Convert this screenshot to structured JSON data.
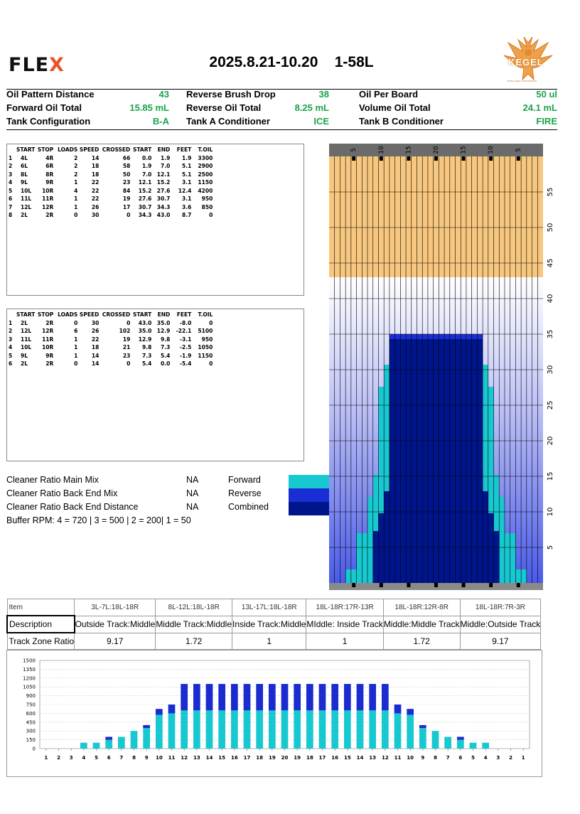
{
  "brand": {
    "name_main": "FLE",
    "name_x": "X",
    "kegel_text": "KEGEL",
    "kegel_tagline": "YOUR LANES. OUR PASSION."
  },
  "title": "2025.8.21-10.20    1-58L",
  "colors": {
    "green": "#19a34a",
    "dry": "#f7c77f",
    "white_band": "#ffffff",
    "forward": "#18c8d0",
    "reverse": "#1a2ed6",
    "combined": "#00158c"
  },
  "info": [
    {
      "label": "Oil Pattern Distance",
      "value": "43"
    },
    {
      "label": "Reverse Brush Drop",
      "value": "38"
    },
    {
      "label": "Oil Per Board",
      "value": "50 ul"
    },
    {
      "label": "Forward Oil Total",
      "value": "15.85 mL"
    },
    {
      "label": "Reverse Oil Total",
      "value": "8.25 mL"
    },
    {
      "label": "Volume Oil Total",
      "value": "24.1 mL"
    },
    {
      "label": "Tank Configuration",
      "value": "B-A"
    },
    {
      "label": "Tank A Conditioner",
      "value": "ICE"
    },
    {
      "label": "Tank B Conditioner",
      "value": "FIRE"
    }
  ],
  "columns": [
    "",
    "START",
    "STOP",
    "LOADS",
    "SPEED",
    "CROSSED",
    "START",
    "END",
    "FEET",
    "T.OIL"
  ],
  "forward": [
    [
      "1",
      "4L",
      "4R",
      "2",
      "14",
      "66",
      "0.0",
      "1.9",
      "1.9",
      "3300"
    ],
    [
      "2",
      "6L",
      "6R",
      "2",
      "18",
      "58",
      "1.9",
      "7.0",
      "5.1",
      "2900"
    ],
    [
      "3",
      "8L",
      "8R",
      "2",
      "18",
      "50",
      "7.0",
      "12.1",
      "5.1",
      "2500"
    ],
    [
      "4",
      "9L",
      "9R",
      "1",
      "22",
      "23",
      "12.1",
      "15.2",
      "3.1",
      "1150"
    ],
    [
      "5",
      "10L",
      "10R",
      "4",
      "22",
      "84",
      "15.2",
      "27.6",
      "12.4",
      "4200"
    ],
    [
      "6",
      "11L",
      "11R",
      "1",
      "22",
      "19",
      "27.6",
      "30.7",
      "3.1",
      "950"
    ],
    [
      "7",
      "12L",
      "12R",
      "1",
      "26",
      "17",
      "30.7",
      "34.3",
      "3.6",
      "850"
    ],
    [
      "8",
      "2L",
      "2R",
      "0",
      "30",
      "0",
      "34.3",
      "43.0",
      "8.7",
      "0"
    ]
  ],
  "reverse": [
    [
      "1",
      "2L",
      "2R",
      "0",
      "30",
      "0",
      "43.0",
      "35.0",
      "-8.0",
      "0"
    ],
    [
      "2",
      "12L",
      "12R",
      "6",
      "26",
      "102",
      "35.0",
      "12.9",
      "-22.1",
      "5100"
    ],
    [
      "3",
      "11L",
      "11R",
      "1",
      "22",
      "19",
      "12.9",
      "9.8",
      "-3.1",
      "950"
    ],
    [
      "4",
      "10L",
      "10R",
      "1",
      "18",
      "21",
      "9.8",
      "7.3",
      "-2.5",
      "1050"
    ],
    [
      "5",
      "9L",
      "9R",
      "1",
      "14",
      "23",
      "7.3",
      "5.4",
      "-1.9",
      "1150"
    ],
    [
      "6",
      "2L",
      "2R",
      "0",
      "14",
      "0",
      "5.4",
      "0.0",
      "-5.4",
      "0"
    ]
  ],
  "cleaner": [
    {
      "label": "Cleaner Ratio Main Mix",
      "value": "NA",
      "legend": "Forward"
    },
    {
      "label": "Cleaner Ratio Back End Mix",
      "value": "NA",
      "legend": "Reverse"
    },
    {
      "label": "Cleaner Ratio Back End Distance",
      "value": "NA",
      "legend": "Combined"
    }
  ],
  "buffer": "Buffer RPM: 4 = 720 | 3 = 500 | 2 = 200| 1 = 50",
  "lane_graph": {
    "board_labels": [
      "5",
      "10",
      "15",
      "20",
      "15",
      "10",
      "5"
    ],
    "feet_labels": [
      "55",
      "50",
      "45",
      "40",
      "35",
      "30",
      "25",
      "20",
      "15",
      "10",
      "5"
    ]
  },
  "track": {
    "header": [
      "Item",
      "3L-7L:18L-18R",
      "8L-12L:18L-18R",
      "13L-17L:18L-18R",
      "18L-18R:17R-13R",
      "18L-18R:12R-8R",
      "18L-18R:7R-3R"
    ],
    "description": [
      "Description",
      "Outside Track:Middle",
      "Middle Track:Middle",
      "Inside Track:Middle",
      "MIddle: Inside Track",
      "Middle:Middle Track",
      "Middle:Outside Track"
    ],
    "ratio": [
      "Track Zone Ratio",
      "9.17",
      "1.72",
      "1",
      "1",
      "1.72",
      "9.17"
    ]
  },
  "chart_data": {
    "type": "bar",
    "stacked": true,
    "categories": [
      "1",
      "2",
      "3",
      "4",
      "5",
      "6",
      "7",
      "8",
      "9",
      "10",
      "11",
      "12",
      "13",
      "14",
      "15",
      "16",
      "17",
      "18",
      "19",
      "20",
      "19",
      "18",
      "17",
      "16",
      "15",
      "14",
      "13",
      "12",
      "11",
      "10",
      "9",
      "8",
      "7",
      "6",
      "5",
      "4",
      "3",
      "2",
      "1"
    ],
    "series": [
      {
        "name": "Forward",
        "values": [
          0,
          0,
          0,
          100,
          100,
          150,
          200,
          300,
          350,
          575,
          600,
          650,
          650,
          650,
          650,
          650,
          650,
          650,
          650,
          650,
          650,
          650,
          650,
          650,
          650,
          650,
          650,
          650,
          600,
          575,
          350,
          300,
          200,
          150,
          100,
          100,
          0,
          0,
          0
        ]
      },
      {
        "name": "Reverse",
        "values": [
          0,
          0,
          0,
          0,
          0,
          50,
          0,
          0,
          50,
          100,
          150,
          450,
          450,
          450,
          450,
          450,
          450,
          450,
          450,
          450,
          450,
          450,
          450,
          450,
          450,
          450,
          450,
          450,
          150,
          100,
          50,
          0,
          0,
          50,
          0,
          0,
          0,
          0,
          0
        ]
      }
    ],
    "yticks": [
      "1500",
      "1350",
      "1200",
      "1050",
      "900",
      "750",
      "600",
      "450",
      "300",
      "150",
      "0"
    ],
    "ylim": [
      0,
      1500
    ],
    "grid": true
  }
}
